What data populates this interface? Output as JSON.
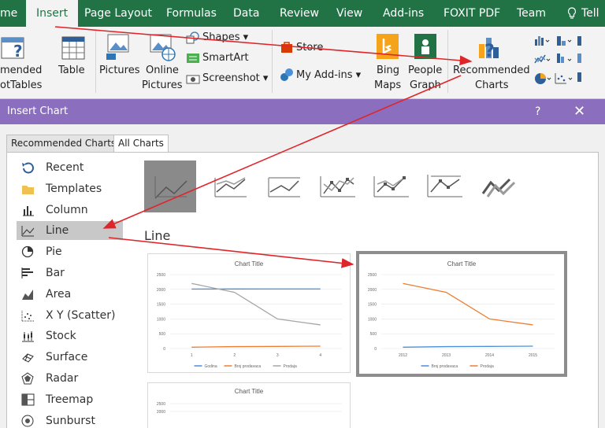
{
  "ribbon_tabs": [
    "me",
    "Insert",
    "Page Layout",
    "Formulas",
    "Data",
    "Review",
    "View",
    "Add-ins",
    "FOXIT PDF",
    "Team",
    "Tell"
  ],
  "ribbon": {
    "pivot_line1": "mended",
    "pivot_line2": "otTables",
    "table": "Table",
    "pictures": "Pictures",
    "online1": "Online",
    "online2": "Pictures",
    "shapes": "Shapes",
    "smartart": "SmartArt",
    "screenshot": "Screenshot",
    "store": "Store",
    "myaddins": "My Add-ins",
    "bing1": "Bing",
    "bing2": "Maps",
    "people1": "People",
    "people2": "Graph",
    "rec1": "Recommended",
    "rec2": "Charts"
  },
  "dialog": {
    "title": "Insert Chart",
    "help": "?",
    "close": "✕",
    "tabs": [
      "Recommended Charts",
      "All Charts"
    ],
    "categories": [
      {
        "label": "Recent",
        "icon": "recent-icon"
      },
      {
        "label": "Templates",
        "icon": "folder-icon"
      },
      {
        "label": "Column",
        "icon": "column-chart-icon"
      },
      {
        "label": "Line",
        "icon": "line-chart-icon"
      },
      {
        "label": "Pie",
        "icon": "pie-chart-icon"
      },
      {
        "label": "Bar",
        "icon": "bar-chart-icon"
      },
      {
        "label": "Area",
        "icon": "area-chart-icon"
      },
      {
        "label": "X Y (Scatter)",
        "icon": "scatter-chart-icon"
      },
      {
        "label": "Stock",
        "icon": "stock-chart-icon"
      },
      {
        "label": "Surface",
        "icon": "surface-chart-icon"
      },
      {
        "label": "Radar",
        "icon": "radar-chart-icon"
      },
      {
        "label": "Treemap",
        "icon": "treemap-icon"
      },
      {
        "label": "Sunburst",
        "icon": "sunburst-icon"
      }
    ],
    "section_title": "Line"
  },
  "chart_data": [
    {
      "type": "line",
      "title": "Chart Title",
      "x": [
        "1",
        "2",
        "3",
        "4"
      ],
      "yticks": [
        "2500",
        "2000",
        "1500",
        "1000",
        "500",
        "0"
      ],
      "ylim": [
        0,
        2500
      ],
      "series": [
        {
          "name": "Godina",
          "values": [
            2012,
            2013,
            2014,
            2015
          ],
          "color": "#4a90d9"
        },
        {
          "name": "Broj prodavaca",
          "values": [
            45,
            65,
            72,
            80
          ],
          "color": "#ed7d31"
        },
        {
          "name": "Prodaja",
          "values": [
            2200,
            1900,
            1000,
            800
          ],
          "color": "#a5a5a5"
        }
      ]
    },
    {
      "type": "line",
      "title": "Chart Title",
      "x": [
        "2012",
        "2013",
        "2014",
        "2015"
      ],
      "yticks": [
        "2500",
        "2000",
        "1500",
        "1000",
        "500",
        "0"
      ],
      "ylim": [
        0,
        2500
      ],
      "series": [
        {
          "name": "Broj prodavaca",
          "values": [
            45,
            65,
            72,
            80
          ],
          "color": "#4a90d9"
        },
        {
          "name": "Prodaja",
          "values": [
            2200,
            1900,
            1000,
            800
          ],
          "color": "#ed7d31"
        }
      ]
    },
    {
      "type": "line",
      "title": "Chart Title",
      "yticks": [
        "2500",
        "2000"
      ],
      "ylim": [
        0,
        2500
      ],
      "x": [],
      "series": []
    }
  ]
}
